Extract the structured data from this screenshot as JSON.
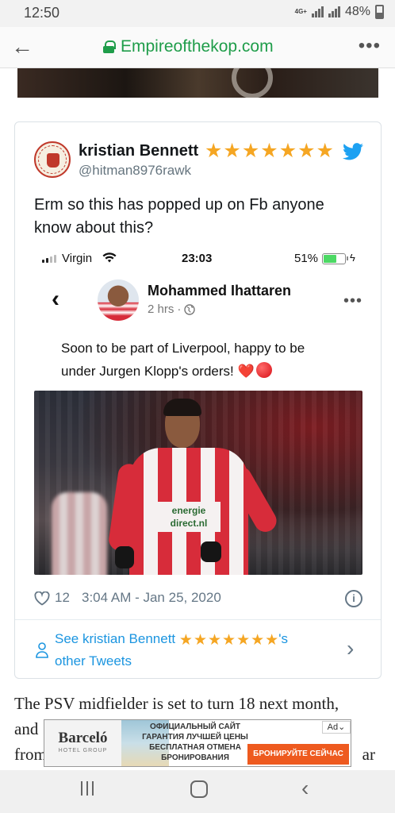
{
  "status_bar": {
    "time": "12:50",
    "network": "4G+",
    "battery": "48%"
  },
  "browser": {
    "back_icon": "arrow-left-icon",
    "url": "Empireofthekop.com",
    "menu_icon": "more-vert-icon"
  },
  "tweet": {
    "user_name": "kristian Bennett",
    "star_count": 7,
    "handle": "@hitman8976rawk",
    "text_line1": "Erm so this has popped up on Fb anyone",
    "text_line2": "know about this?",
    "like_count": "12",
    "timestamp": "3:04 AM - Jan 25, 2020",
    "see_prefix": "See kristian Bennett",
    "see_suffix": "'s",
    "see_line2": "other Tweets",
    "colors": {
      "link": "#1b95e0",
      "star": "#f5a623",
      "twitter": "#1da1f2"
    }
  },
  "embed": {
    "ios_status": {
      "carrier": "Virgin",
      "time": "23:03",
      "battery": "51%"
    },
    "fb_post": {
      "name": "Mohammed Ihattaren",
      "time_ago": "2 hrs",
      "dot": "·",
      "text_line1": "Soon to be part of Liverpool, happy to be",
      "text_line2": "under Jurgen Klopp's orders!",
      "emoji": "❤️",
      "sponsor_line1": "energie",
      "sponsor_line2": "direct.nl"
    }
  },
  "article": {
    "line1": "The PSV midfielder is set to turn 18 next month,",
    "line2_start": "and",
    "line3_start": "from",
    "line3_end": "ar"
  },
  "ad": {
    "logo": "Barceló",
    "logo_sub": "HOTEL GROUP",
    "line1": "ОФИЦИАЛЬНЫЙ САЙТ",
    "line2": "ГАРАНТИЯ ЛУЧШЕЙ ЦЕНЫ",
    "line3": "БЕСПЛАТНАЯ ОТМЕНА",
    "line4": "БРОНИРОВАНИЯ",
    "cta": "БРОНИРУЙТЕ СЕЙЧАС",
    "choice": "Ad"
  },
  "nav": {
    "recents_icon": "recents-icon",
    "home_icon": "home-icon",
    "back_icon": "back-icon"
  }
}
